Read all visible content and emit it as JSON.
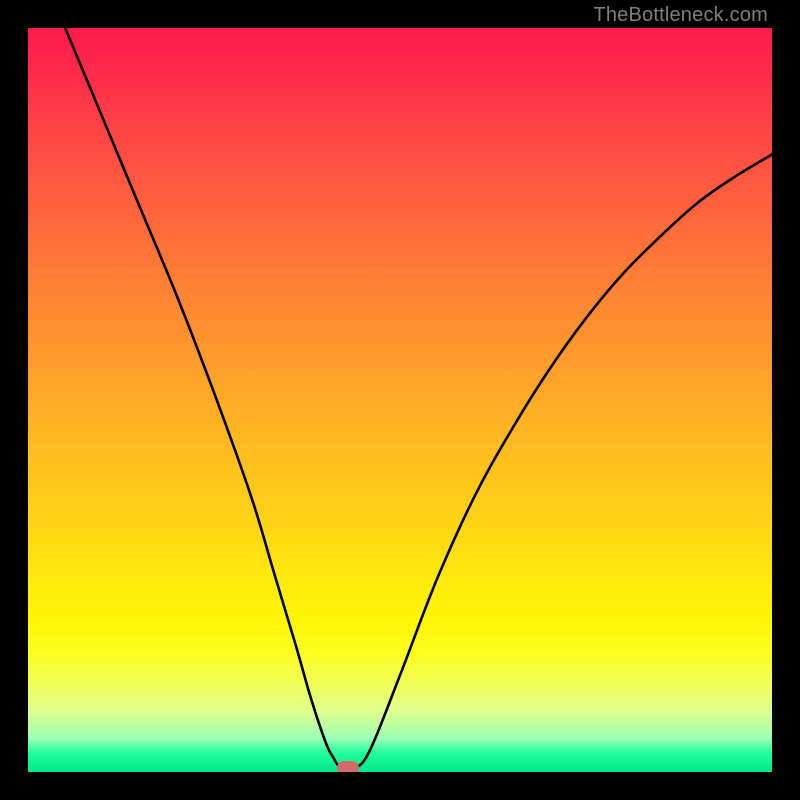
{
  "watermark": "TheBottleneck.com",
  "colors": {
    "frame": "#000000",
    "curve": "#000000",
    "marker": "#d46a6a",
    "watermark": "#7f7f7f"
  },
  "chart_data": {
    "type": "line",
    "title": "",
    "xlabel": "",
    "ylabel": "",
    "xlim": [
      0,
      100
    ],
    "ylim": [
      0,
      100
    ],
    "grid": false,
    "series": [
      {
        "name": "bottleneck-curve",
        "x": [
          5,
          10,
          15,
          20,
          25,
          30,
          33,
          36,
          38,
          40,
          41,
          42,
          43,
          44,
          46,
          50,
          55,
          60,
          65,
          70,
          75,
          80,
          85,
          90,
          95,
          100
        ],
        "values": [
          100,
          88,
          76,
          64,
          51,
          37,
          27,
          17,
          10,
          4,
          2,
          0.5,
          0.5,
          0.5,
          3,
          13,
          26,
          37,
          46,
          54,
          61,
          67,
          72,
          76.5,
          80,
          83
        ]
      }
    ],
    "annotations": [
      {
        "name": "optimal-marker",
        "x": 43,
        "y": 0.5
      }
    ],
    "background_gradient": {
      "type": "vertical",
      "stops": [
        {
          "pos": 0.0,
          "color": "#ff1a4d"
        },
        {
          "pos": 0.5,
          "color": "#ffaa22"
        },
        {
          "pos": 0.8,
          "color": "#fff506"
        },
        {
          "pos": 0.97,
          "color": "#1fff9a"
        },
        {
          "pos": 1.0,
          "color": "#00e688"
        }
      ]
    }
  }
}
